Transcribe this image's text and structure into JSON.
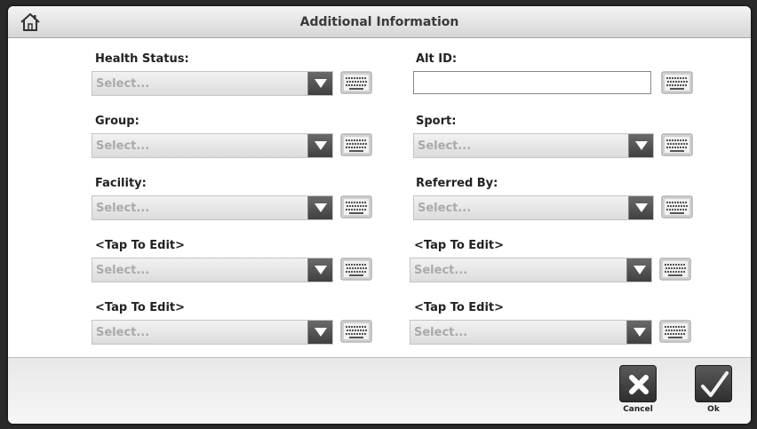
{
  "header": {
    "title": "Additional Information"
  },
  "fields": {
    "health_status": {
      "label": "Health Status:",
      "value": "Select..."
    },
    "alt_id": {
      "label": "Alt ID:",
      "value": ""
    },
    "group": {
      "label": "Group:",
      "value": "Select..."
    },
    "sport": {
      "label": "Sport:",
      "value": "Select..."
    },
    "facility": {
      "label": "Facility:",
      "value": "Select..."
    },
    "referred_by": {
      "label": "Referred By:",
      "value": "Select..."
    },
    "custom_1": {
      "label": "<Tap To Edit>",
      "value": "Select..."
    },
    "custom_2": {
      "label": "<Tap To Edit>",
      "value": "Select..."
    },
    "custom_3": {
      "label": "<Tap To Edit>",
      "value": "Select..."
    },
    "custom_4": {
      "label": "<Tap To Edit>",
      "value": "Select..."
    }
  },
  "footer": {
    "cancel_label": "Cancel",
    "ok_label": "Ok"
  },
  "icons": {
    "home": "home-icon",
    "dropdown": "triangle-down-icon",
    "keyboard": "keyboard-icon",
    "cancel": "x-icon",
    "ok": "checkmark-icon"
  }
}
